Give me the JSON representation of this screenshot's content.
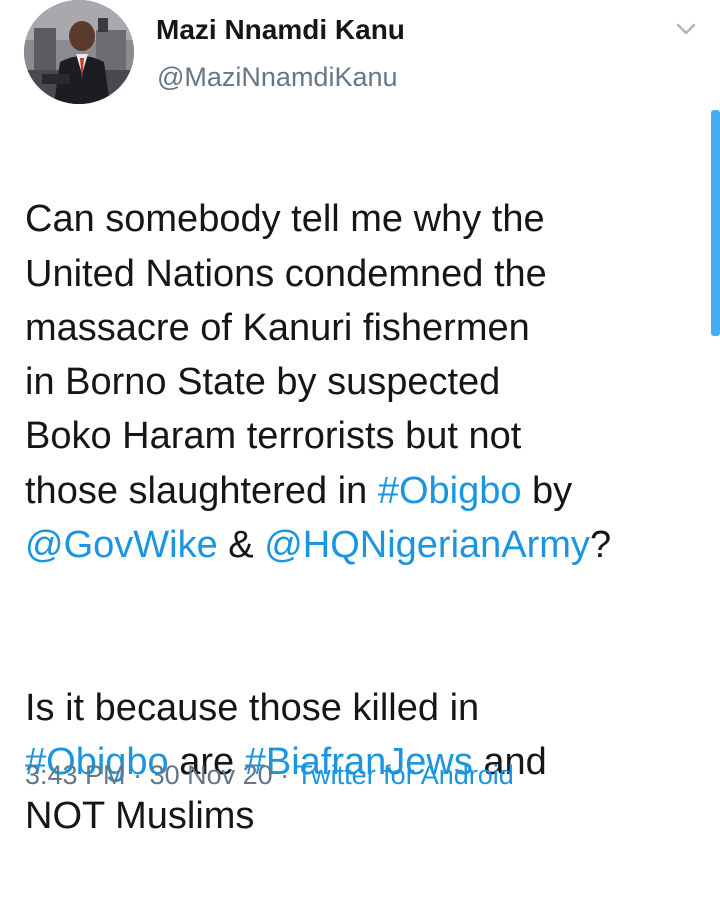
{
  "author": {
    "name": "Mazi Nnamdi Kanu",
    "handle": "@MaziNnamdiKanu"
  },
  "tweet": {
    "p1": {
      "t1": "Can somebody tell me why the\nUnited Nations condemned the\nmassacre of Kanuri fishermen\nin Borno State by suspected\nBoko Haram terrorists but not\nthose slaughtered in ",
      "hashtag1": "#Obigbo",
      "t2": " by\n",
      "mention1": "@GovWike",
      "t3": " & ",
      "mention2": "@HQNigerianArmy",
      "t4": "?"
    },
    "p2": {
      "t1": "Is it because those killed in\n",
      "hashtag1": "#Obigbo",
      "t2": " are ",
      "hashtag2": "#BiafranJews",
      "t3": " and\nNOT Muslims"
    }
  },
  "meta": {
    "time": "3:43 PM",
    "sep1": " · ",
    "date": "30 Nov 20",
    "sep2": " · ",
    "source": "Twitter for Android"
  },
  "icons": {
    "caret": "chevron-down-icon"
  },
  "colors": {
    "link": "#1b95e0",
    "secondary_text": "#657786",
    "scrollbar": "#42aef3"
  }
}
